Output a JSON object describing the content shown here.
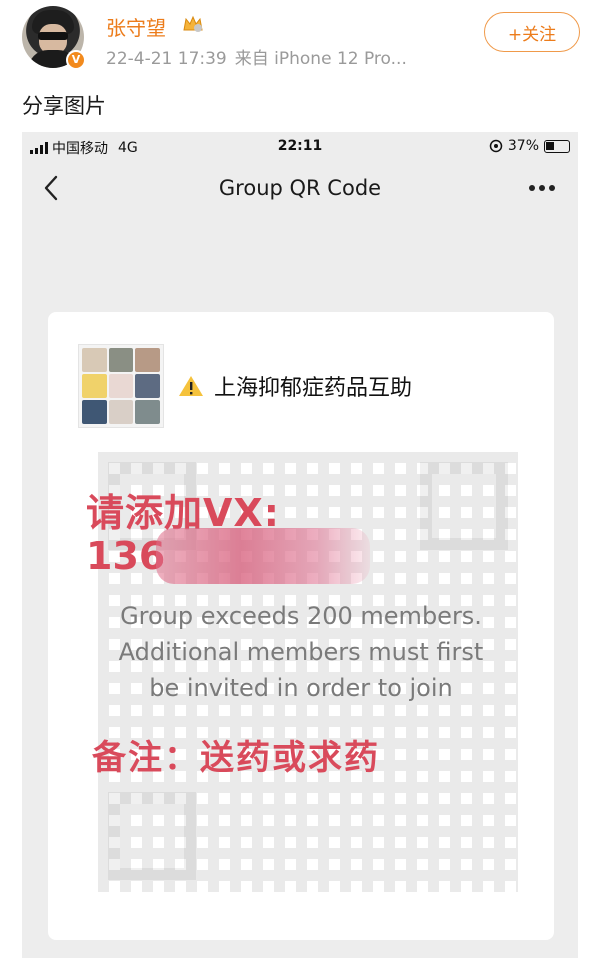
{
  "post": {
    "username": "张守望",
    "timestamp": "22-4-21 17:39",
    "source": "来自 iPhone 12 Pro...",
    "follow_label": "+关注",
    "text": "分享图片",
    "verified_badge": "V"
  },
  "screenshot": {
    "status_bar": {
      "carrier": "中国移动",
      "network": "4G",
      "time": "22:11",
      "battery": "37%"
    },
    "nav": {
      "title": "Group QR Code"
    },
    "card": {
      "group_name": "上海抑郁症药品互助",
      "vx_label": "请添加VX:",
      "phone_prefix": "136",
      "info_lines": [
        "Group exceeds 200 members.",
        "Additional members must first",
        "be invited in order to join"
      ],
      "note": "备注：送药或求药"
    }
  },
  "colors": {
    "accent_orange": "#ec7c1b",
    "overlay_red": "#d94a5b",
    "background_gray": "#ededed"
  },
  "icons": [
    "avatar",
    "crown-icon",
    "verified-icon",
    "signal-icon",
    "alarm-icon",
    "battery-icon",
    "back-icon",
    "more-icon",
    "warning-icon",
    "group-avatar"
  ]
}
